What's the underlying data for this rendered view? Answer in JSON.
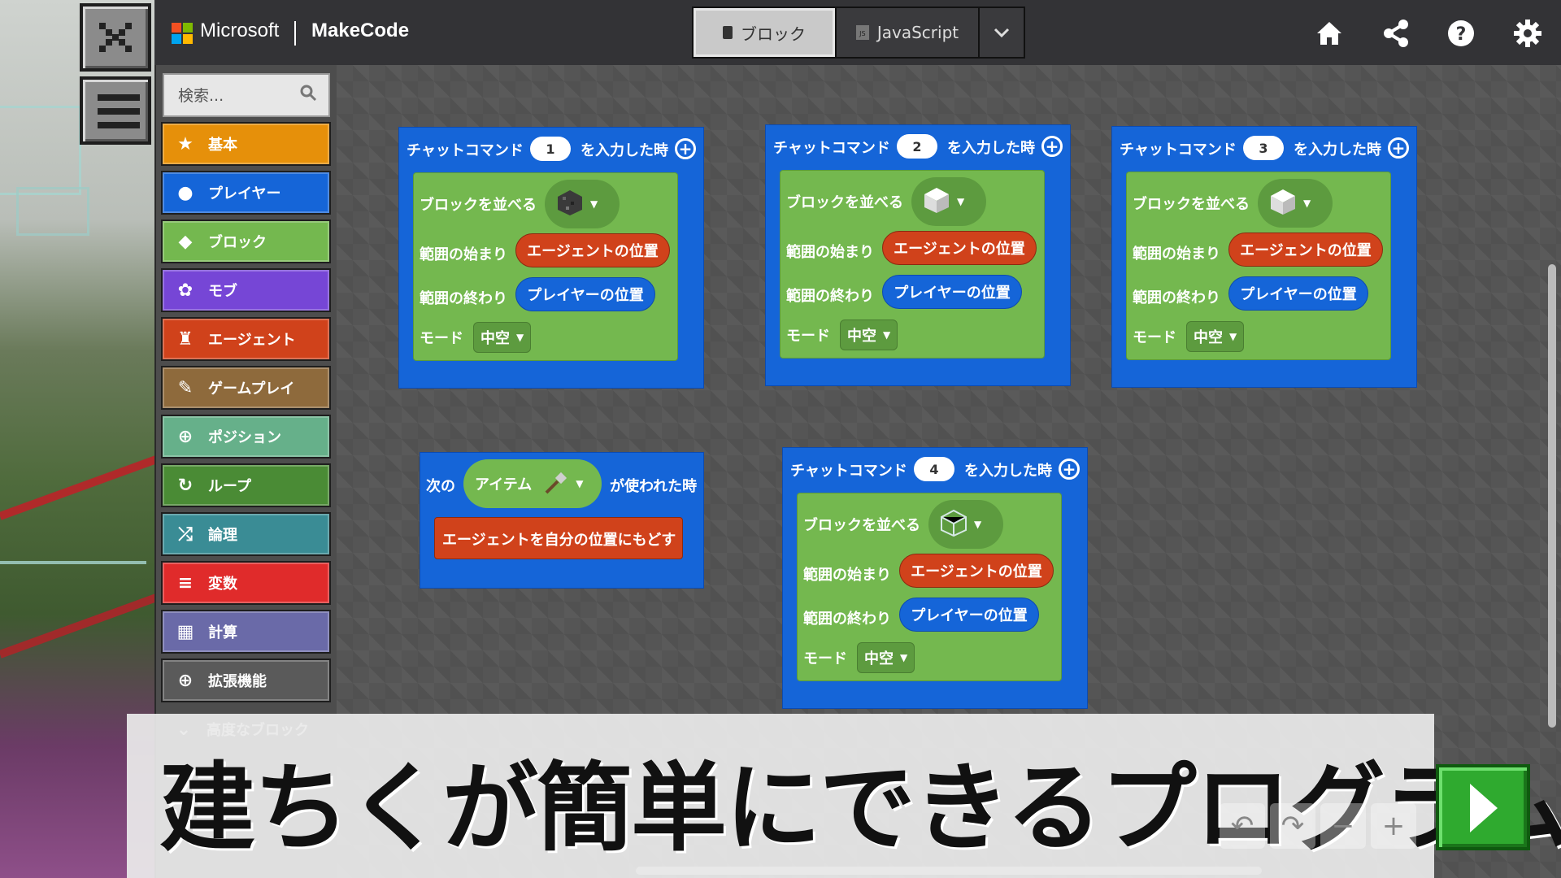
{
  "header": {
    "brand": "Microsoft",
    "product": "MakeCode",
    "toggle": {
      "blocks_label": "ブロック",
      "js_label": "JavaScript"
    },
    "icons": [
      "home-icon",
      "share-icon",
      "help-icon",
      "settings-icon"
    ]
  },
  "sidebar": {
    "search_placeholder": "検索...",
    "categories": [
      {
        "label": "基本",
        "icon": "star-icon",
        "color": "#e6900a"
      },
      {
        "label": "プレイヤー",
        "icon": "player-icon",
        "color": "#1565d8"
      },
      {
        "label": "ブロック",
        "icon": "cube-icon",
        "color": "#74b84f"
      },
      {
        "label": "モブ",
        "icon": "paw-icon",
        "color": "#7646d6"
      },
      {
        "label": "エージェント",
        "icon": "agent-icon",
        "color": "#d0421b"
      },
      {
        "label": "ゲームプレイ",
        "icon": "wrench-icon",
        "color": "#8e6a3c"
      },
      {
        "label": "ポジション",
        "icon": "crosshair-icon",
        "color": "#66b08a"
      },
      {
        "label": "ループ",
        "icon": "loop-icon",
        "color": "#4a8b35"
      },
      {
        "label": "論理",
        "icon": "shuffle-icon",
        "color": "#3a8c95"
      },
      {
        "label": "変数",
        "icon": "list-icon",
        "color": "#e02b2b"
      },
      {
        "label": "計算",
        "icon": "calculator-icon",
        "color": "#6a6aa8"
      },
      {
        "label": "拡張機能",
        "icon": "plus-circle-icon",
        "color": "#5a5a5a"
      },
      {
        "label": "高度なブロック",
        "icon": "chevron-down-icon",
        "color": "#4d4d4d"
      }
    ]
  },
  "workspace": {
    "chat_blocks": [
      {
        "prefix": "チャットコマンド",
        "number": "1",
        "suffix": "を入力した時",
        "fill_label": "ブロックを並べる",
        "block_icon": "bedrock",
        "from_label": "範囲の始まり",
        "from_value": "エージェントの位置",
        "to_label": "範囲の終わり",
        "to_value": "プレイヤーの位置",
        "mode_label": "モード",
        "mode_value": "中空"
      },
      {
        "prefix": "チャットコマンド",
        "number": "2",
        "suffix": "を入力した時",
        "fill_label": "ブロックを並べる",
        "block_icon": "quartz",
        "from_label": "範囲の始まり",
        "from_value": "エージェントの位置",
        "to_label": "範囲の終わり",
        "to_value": "プレイヤーの位置",
        "mode_label": "モード",
        "mode_value": "中空"
      },
      {
        "prefix": "チャットコマンド",
        "number": "3",
        "suffix": "を入力した時",
        "fill_label": "ブロックを並べる",
        "block_icon": "quartz",
        "from_label": "範囲の始まり",
        "from_value": "エージェントの位置",
        "to_label": "範囲の終わり",
        "to_value": "プレイヤーの位置",
        "mode_label": "モード",
        "mode_value": "中空"
      },
      {
        "prefix": "チャットコマンド",
        "number": "4",
        "suffix": "を入力した時",
        "fill_label": "ブロックを並べる",
        "block_icon": "glass",
        "from_label": "範囲の始まり",
        "from_value": "エージェントの位置",
        "to_label": "範囲の終わり",
        "to_value": "プレイヤーの位置",
        "mode_label": "モード",
        "mode_value": "中空"
      }
    ],
    "item_block": {
      "prefix": "次の",
      "item_label": "アイテム",
      "item_icon": "shovel-icon",
      "suffix": "が使われた時",
      "action": "エージェントを自分の位置にもどす"
    }
  },
  "caption": "建ちくが簡単にできるプログラム",
  "colors": {
    "blue": "#1565d8",
    "green": "#74b84f",
    "red": "#d0421b",
    "header": "#333336"
  }
}
